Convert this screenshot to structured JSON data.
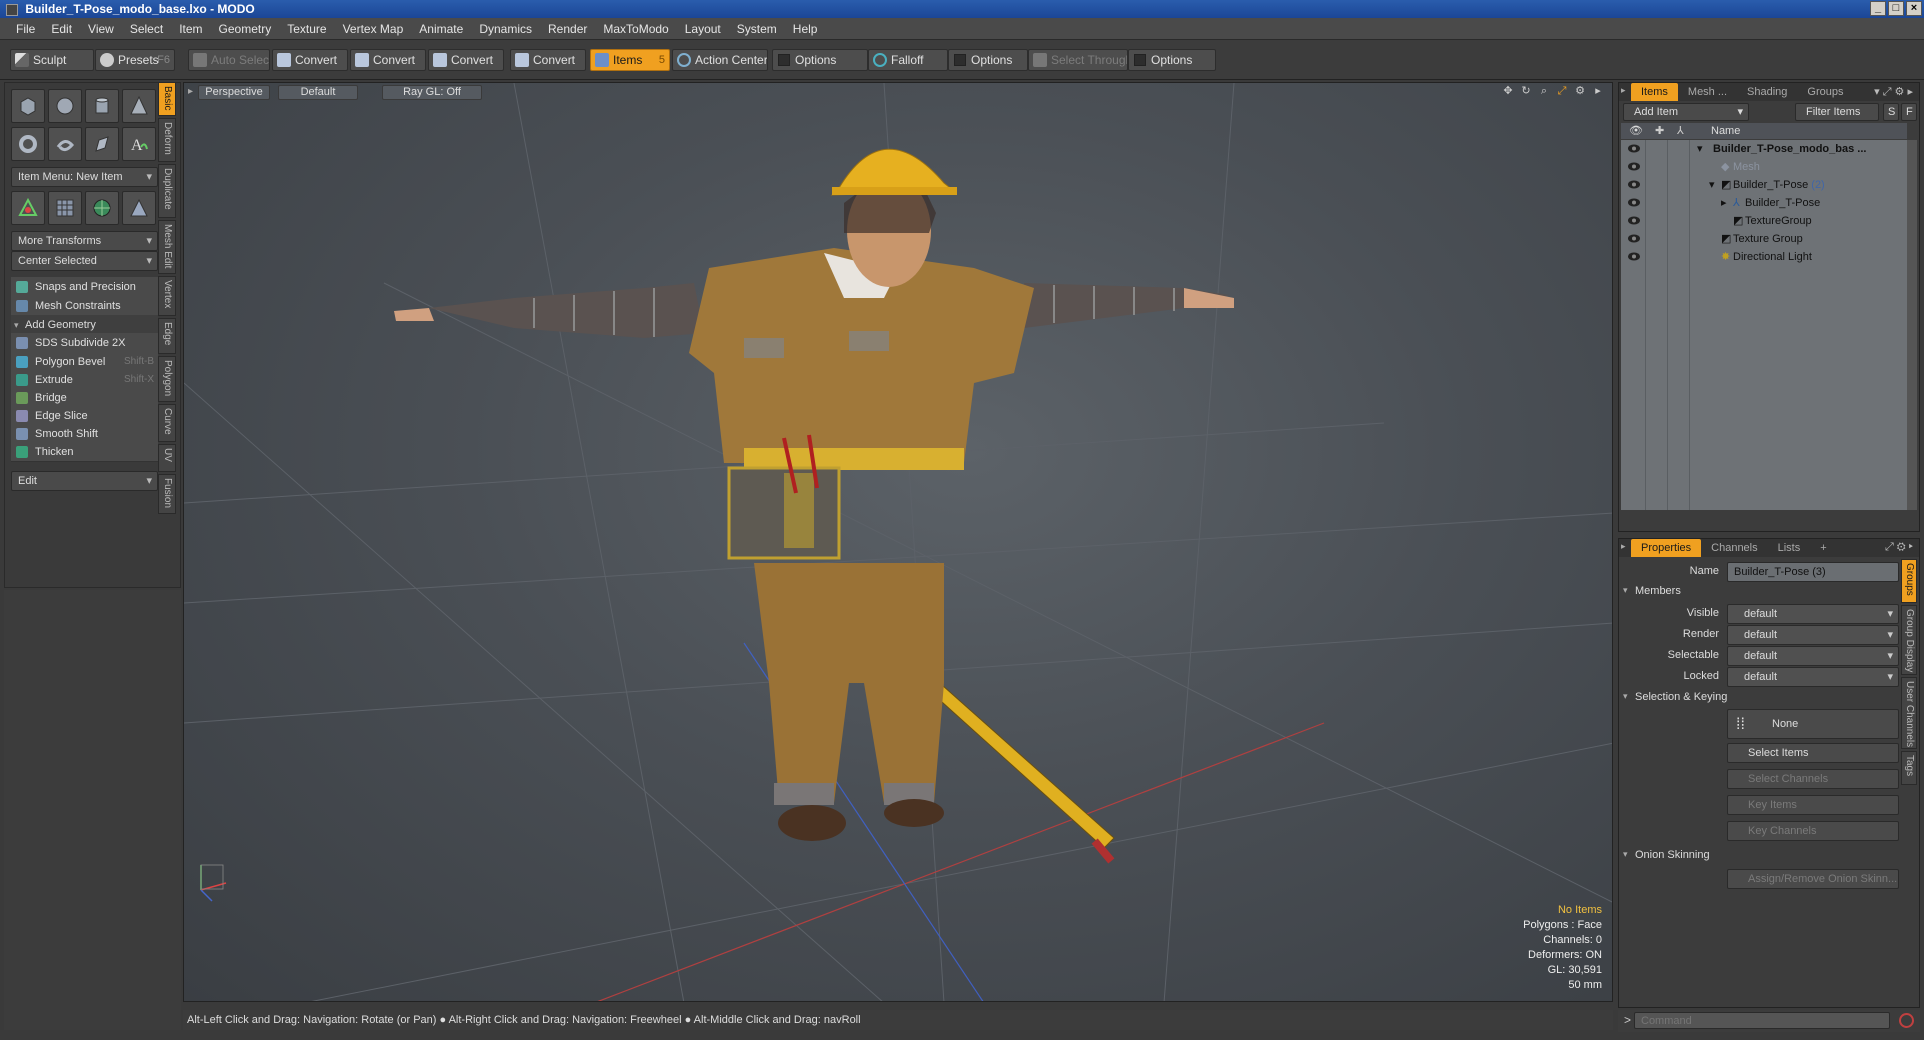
{
  "window": {
    "title": "Builder_T-Pose_modo_base.lxo - MODO"
  },
  "menu": [
    "File",
    "Edit",
    "View",
    "Select",
    "Item",
    "Geometry",
    "Texture",
    "Vertex Map",
    "Animate",
    "Dynamics",
    "Render",
    "MaxToModo",
    "Layout",
    "System",
    "Help"
  ],
  "toolbar": {
    "sculpt": "Sculpt",
    "presets": "Presets",
    "presets_hotkey": "F6",
    "auto_select": "Auto Select",
    "convert1": "Convert",
    "convert2": "Convert",
    "convert3": "Convert",
    "convert4": "Convert",
    "items": "Items",
    "items_hotkey": "5",
    "action_center": "Action Center",
    "options1": "Options",
    "falloff": "Falloff",
    "options2": "Options",
    "select_through": "Select Through",
    "options3": "Options"
  },
  "left_tabs": [
    "Basic",
    "Deform",
    "Duplicate",
    "Mesh Edit",
    "Vertex",
    "Edge",
    "Polygon",
    "Curve",
    "UV",
    "Fusion"
  ],
  "left_panel": {
    "item_menu": "Item Menu: New Item",
    "more_transforms": "More Transforms",
    "center_selected": "Center Selected",
    "snaps": "Snaps and Precision",
    "mesh_constraints": "Mesh Constraints",
    "add_geometry": "Add Geometry",
    "sds": "SDS Subdivide 2X",
    "polygon_bevel": "Polygon Bevel",
    "polygon_bevel_hk": "Shift-B",
    "extrude": "Extrude",
    "extrude_hk": "Shift-X",
    "bridge": "Bridge",
    "edge_slice": "Edge Slice",
    "smooth_shift": "Smooth Shift",
    "thicken": "Thicken",
    "edit": "Edit"
  },
  "viewport": {
    "view": "Perspective",
    "style": "Default",
    "raygl": "Ray GL: Off",
    "info": {
      "no_items": "No Items",
      "polygons": "Polygons : Face",
      "channels": "Channels: 0",
      "deformers": "Deformers: ON",
      "gl": "GL: 30,591",
      "size": "50 mm"
    }
  },
  "statusbar": "Alt-Left Click and Drag: Navigation: Rotate (or Pan) ● Alt-Right Click and Drag: Navigation: Freewheel ● Alt-Middle Click and Drag: navRoll",
  "items_panel": {
    "tabs": [
      "Items",
      "Mesh ...",
      "Shading",
      "Groups"
    ],
    "add_item": "Add Item",
    "filter_items": "Filter Items",
    "s_btn": "S",
    "f_btn": "F",
    "name_header": "Name",
    "tree": [
      {
        "label": "Builder_T-Pose_modo_bas ...",
        "count": "",
        "dim": false,
        "bold": true
      },
      {
        "label": "Mesh",
        "count": "",
        "dim": true,
        "bold": false
      },
      {
        "label": "Builder_T-Pose",
        "count": "(2)",
        "dim": false,
        "bold": false
      },
      {
        "label": "Builder_T-Pose",
        "count": "",
        "dim": false,
        "bold": false
      },
      {
        "label": "TextureGroup",
        "count": "",
        "dim": false,
        "bold": false
      },
      {
        "label": "Texture Group",
        "count": "",
        "dim": false,
        "bold": false
      },
      {
        "label": "Directional Light",
        "count": "",
        "dim": false,
        "bold": false
      }
    ]
  },
  "props_panel": {
    "tabs": [
      "Properties",
      "Channels",
      "Lists",
      "+"
    ],
    "vtabs": [
      "Groups",
      "Group Display",
      "User Channels",
      "Tags"
    ],
    "name_label": "Name",
    "name_value": "Builder_T-Pose (3)",
    "members": "Members",
    "visible_label": "Visible",
    "visible_value": "default",
    "render_label": "Render",
    "render_value": "default",
    "selectable_label": "Selectable",
    "selectable_value": "default",
    "locked_label": "Locked",
    "locked_value": "default",
    "sel_keying": "Selection & Keying",
    "none": "None",
    "select_items": "Select Items",
    "select_channels": "Select Channels",
    "key_items": "Key Items",
    "key_channels": "Key Channels",
    "onion": "Onion Skinning",
    "assign_onion": "Assign/Remove Onion Skinn..."
  },
  "command": {
    "prompt": ">",
    "placeholder": "Command"
  },
  "colors": {
    "accent": "#f0a020",
    "title_bar": "#2a5dad"
  }
}
